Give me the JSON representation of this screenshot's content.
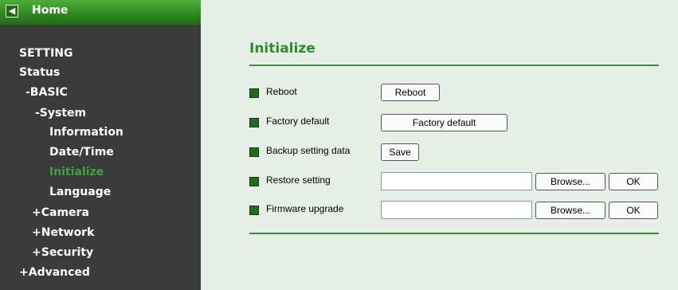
{
  "sidebar": {
    "home_label": "Home",
    "items": [
      {
        "label": "SETTING"
      },
      {
        "label": "Status"
      },
      {
        "label": "-BASIC"
      },
      {
        "label": "-System"
      },
      {
        "label": "Information"
      },
      {
        "label": "Date/Time"
      },
      {
        "label": "Initialize"
      },
      {
        "label": "Language"
      },
      {
        "label": "+Camera"
      },
      {
        "label": "+Network"
      },
      {
        "label": "+Security"
      },
      {
        "label": "+Advanced"
      }
    ]
  },
  "main": {
    "title": "Initialize",
    "rows": [
      {
        "label": "Reboot",
        "button": "Reboot"
      },
      {
        "label": "Factory default",
        "button": "Factory default"
      },
      {
        "label": "Backup setting data",
        "button": "Save"
      },
      {
        "label": "Restore setting",
        "browse": "Browse...",
        "ok": "OK",
        "value": ""
      },
      {
        "label": "Firmware upgrade",
        "browse": "Browse...",
        "ok": "OK",
        "value": ""
      }
    ]
  },
  "colors": {
    "accent": "#2f8a2f",
    "sidebar_bg": "#3b3b3b",
    "content_bg": "#e6efe6",
    "active_item": "#3aa53a"
  }
}
